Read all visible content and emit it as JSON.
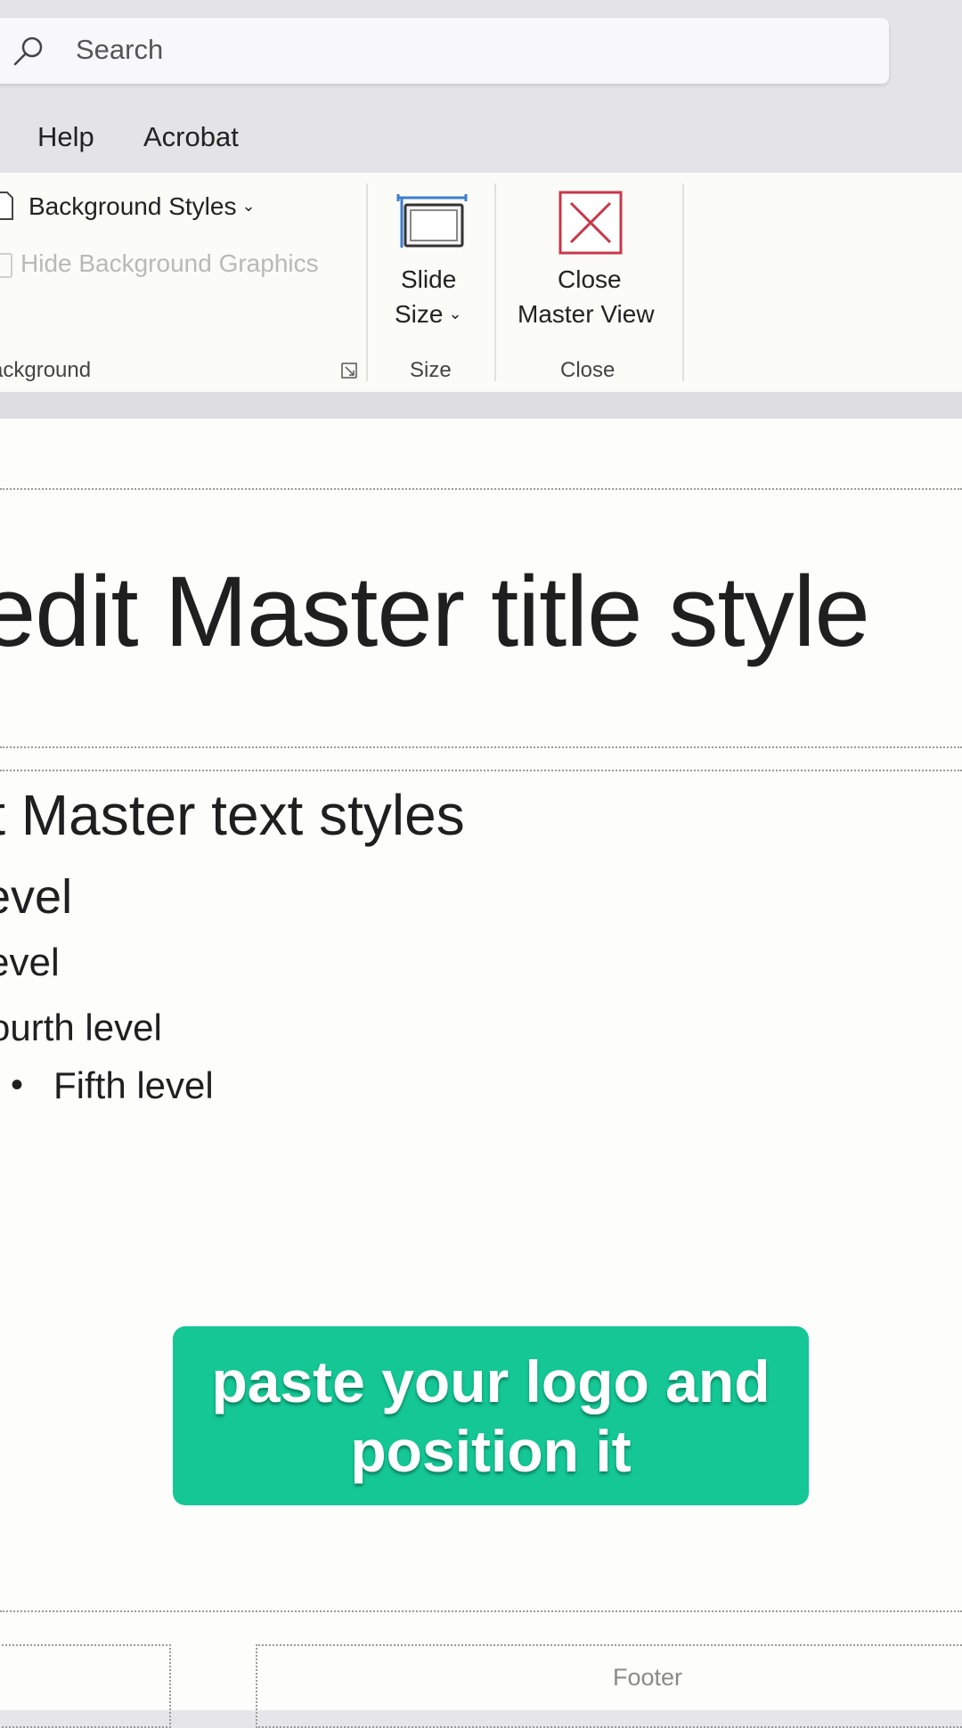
{
  "search": {
    "placeholder": "Search"
  },
  "tabs": [
    "Help",
    "Acrobat"
  ],
  "ribbon": {
    "background_group": {
      "background_styles": "Background Styles",
      "hide_background_graphics": "Hide Background Graphics",
      "label": "ackground"
    },
    "size_group": {
      "slide_size_line1": "Slide",
      "slide_size_line2": "Size",
      "label": "Size"
    },
    "close_group": {
      "close_line1": "Close",
      "close_line2": "Master View",
      "label": "Close"
    }
  },
  "slide": {
    "title": "edit Master title style",
    "levels": [
      "it Master text styles",
      "evel",
      "evel",
      "ourth level",
      "Fifth level"
    ],
    "footer": "Footer"
  },
  "caption": "paste your logo and position it",
  "colors": {
    "caption_bg": "#14c795",
    "close_icon": "#c8374a",
    "ribbon_bg": "#fbfbf7"
  }
}
